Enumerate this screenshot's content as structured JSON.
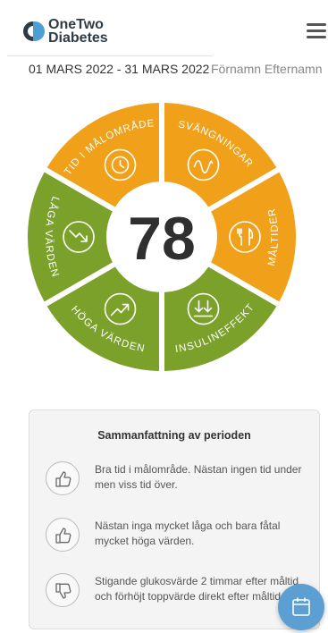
{
  "brand": {
    "line1": "OneTwo",
    "line2": "Diabetes",
    "colors": {
      "dark": "#2f3b45",
      "blue": "#4c9fd4"
    }
  },
  "header": {
    "date_range": "01 MARS 2022 - 31 MARS 2022",
    "user_name": "Förnamn Efternamn"
  },
  "score": {
    "value": "78"
  },
  "segments": [
    {
      "key": "tid_i_malomrade",
      "label": "TID I MÅLOMRÅDE",
      "icon": "clock-icon",
      "color": "#f0a019"
    },
    {
      "key": "svangningar",
      "label": "SVÄNGNINGAR",
      "icon": "wave-icon",
      "color": "#f0a019"
    },
    {
      "key": "maltider",
      "label": "MÅLTIDER",
      "icon": "fork-knife-icon",
      "color": "#f0a019"
    },
    {
      "key": "insulineffekt",
      "label": "INSULINEFFEKT",
      "icon": "insulin-arrows-icon",
      "color": "#7ba12a"
    },
    {
      "key": "hoga_varden",
      "label": "HÖGA VÄRDEN",
      "icon": "trend-up-icon",
      "color": "#7ba12a"
    },
    {
      "key": "laga_varden",
      "label": "LÅGA VÄRDEN",
      "icon": "trend-down-icon",
      "color": "#7ba12a"
    }
  ],
  "summary": {
    "title": "Sammanfattning av perioden",
    "items": [
      {
        "text": "Bra tid i målområde. Nästan ingen tid under men viss tid över.",
        "icon": "thumbs-up-icon"
      },
      {
        "text": "Nästan inga mycket låga och bara fåtal mycket höga värden.",
        "icon": "thumbs-up-icon"
      },
      {
        "text": "Stigande glukosvärde 2 timmar efter måltid och förhöjt toppvärde direkt efter måltid.",
        "icon": "thumbs-down-icon"
      }
    ]
  },
  "fab": {
    "icon": "calendar-icon",
    "color": "#5b9fd3"
  }
}
